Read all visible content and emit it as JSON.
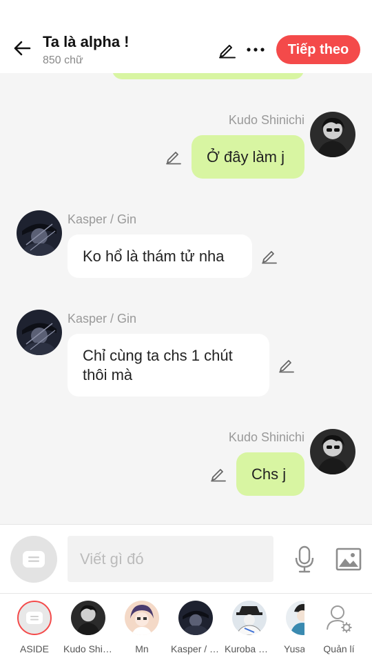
{
  "header": {
    "title": "Ta là alpha !",
    "word_count": "850 chữ",
    "next_label": "Tiếp theo",
    "accent_color": "#f44a4a"
  },
  "messages": [
    {
      "sender": "Kudo Shinichi",
      "side": "right",
      "text": "Ở đây làm j"
    },
    {
      "sender": "Kasper / Gin",
      "side": "left",
      "text": "Ko hổ là thám tử nha"
    },
    {
      "sender": "Kasper / Gin",
      "side": "left",
      "text": "Chỉ cùng ta chs 1 chút thôi mà"
    },
    {
      "sender": "Kudo Shinichi",
      "side": "right",
      "text": "Chs j"
    }
  ],
  "composer": {
    "placeholder": "Viết gì đó"
  },
  "characters": [
    {
      "label": "ASIDE"
    },
    {
      "label": "Kudo Shinichi"
    },
    {
      "label": "Mn"
    },
    {
      "label": "Kasper / Gin"
    },
    {
      "label": "Kuroba Kaito"
    },
    {
      "label": "Yusaku"
    },
    {
      "label": "Quản lí"
    }
  ],
  "colors": {
    "my_bubble": "#d8f5a2",
    "their_bubble": "#ffffff",
    "background": "#f5f5f5"
  }
}
